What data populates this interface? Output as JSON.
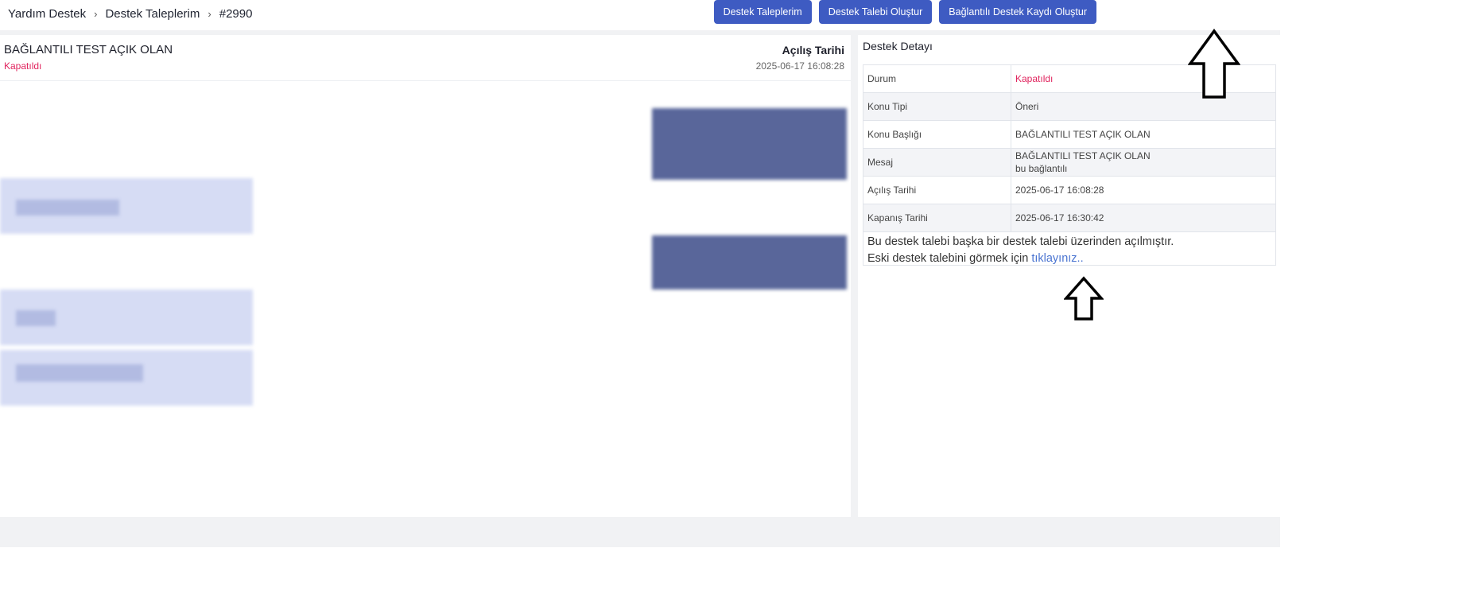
{
  "breadcrumb": {
    "items": [
      "Yardım Destek",
      "Destek Taleplerim",
      "#2990"
    ],
    "separator": "›"
  },
  "top_actions": {
    "btn1": "Destek Taleplerim",
    "btn2": "Destek Talebi Oluştur",
    "btn3": "Bağlantılı Destek Kaydı Oluştur"
  },
  "ticket": {
    "title": "BAĞLANTILI TEST AÇIK OLAN",
    "status": "Kapatıldı",
    "opening_label": "Açılış Tarihi",
    "opening_date": "2025-06-17 16:08:28"
  },
  "details": {
    "title": "Destek Detayı",
    "rows": [
      {
        "key": "Durum",
        "value": "Kapatıldı"
      },
      {
        "key": "Konu Tipi",
        "value": "Öneri"
      },
      {
        "key": "Konu Başlığı",
        "value": "BAĞLANTILI TEST AÇIK OLAN"
      },
      {
        "key": "Mesaj",
        "value": "BAĞLANTILI TEST AÇIK OLAN",
        "value2": "bu bağlantılı"
      },
      {
        "key": "Açılış Tarihi",
        "value": "2025-06-17 16:08:28"
      },
      {
        "key": "Kapanış Tarihi",
        "value": "2025-06-17 16:30:42"
      }
    ],
    "note_line1": "Bu destek talebi başka bir destek talebi üzerinden açılmıştır.",
    "note_line2": "Eski destek talebini görmek için",
    "note_link": "tıklayınız.."
  },
  "colors": {
    "primary": "#3e5bc2",
    "status_red": "#e0245e",
    "link": "#4a74d1"
  }
}
